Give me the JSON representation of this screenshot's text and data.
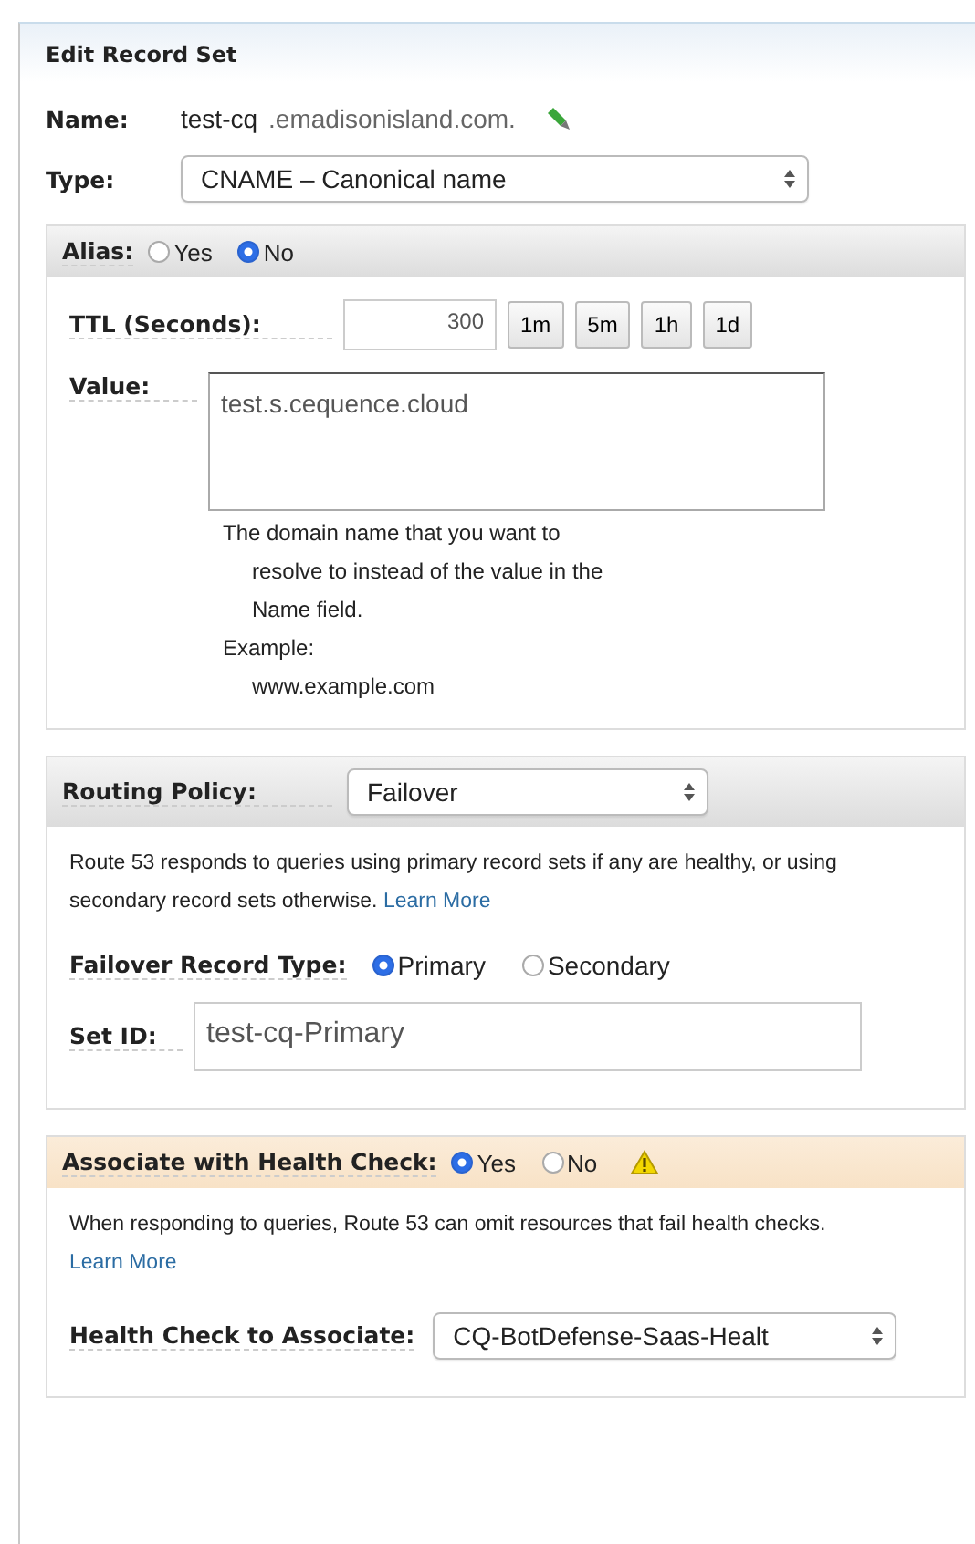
{
  "title": "Edit Record Set",
  "name": {
    "label": "Name:",
    "value": "test-cq",
    "suffix": ".emadisonisland.com."
  },
  "type": {
    "label": "Type:",
    "value": "CNAME – Canonical name"
  },
  "alias": {
    "label": "Alias:",
    "options": [
      {
        "label": "Yes",
        "selected": false
      },
      {
        "label": "No",
        "selected": true
      }
    ]
  },
  "ttl": {
    "label": "TTL (Seconds):",
    "value": "300",
    "buttons": [
      "1m",
      "5m",
      "1h",
      "1d"
    ]
  },
  "value": {
    "label": "Value:",
    "value": "test.s.cequence.cloud",
    "help": [
      "The domain name that you want to",
      "resolve to instead of the value in the",
      "Name field."
    ],
    "example_label": "Example:",
    "example": "www.example.com"
  },
  "routing": {
    "label": "Routing Policy:",
    "value": "Failover",
    "description": "Route 53 responds to queries using primary record sets if any are healthy, or using secondary record sets otherwise.",
    "link": "Learn More",
    "failover": {
      "label": "Failover Record Type:",
      "options": [
        {
          "label": "Primary",
          "selected": true
        },
        {
          "label": "Secondary",
          "selected": false
        }
      ]
    },
    "set_id": {
      "label": "Set ID:",
      "value": "test-cq-Primary"
    }
  },
  "health": {
    "label": "Associate with Health Check:",
    "options": [
      {
        "label": "Yes",
        "selected": true
      },
      {
        "label": "No",
        "selected": false
      }
    ],
    "warning": true,
    "description": "When responding to queries, Route 53 can omit resources that fail health checks.",
    "link": "Learn More",
    "check": {
      "label": "Health Check to Associate:",
      "value": "CQ-BotDefense-Saas-Healt"
    }
  }
}
